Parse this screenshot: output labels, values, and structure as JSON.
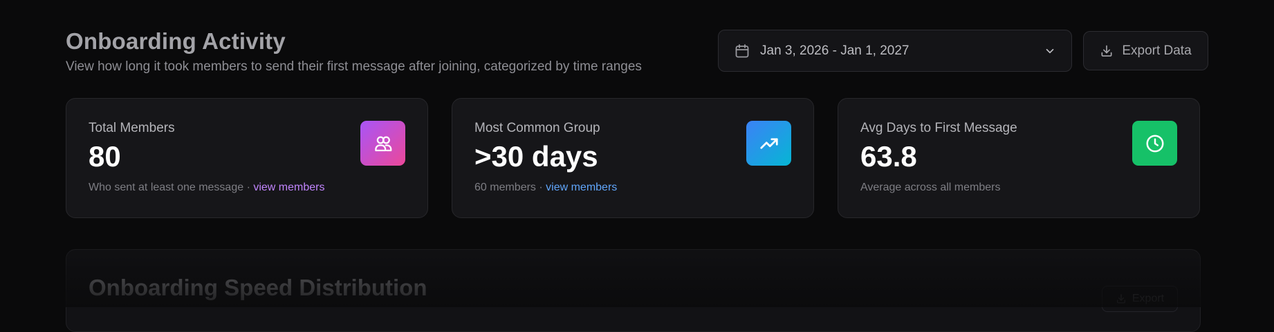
{
  "header": {
    "title": "Onboarding Activity",
    "subtitle": "View how long it took members to send their first message after joining, categorized by time ranges",
    "date_range": "Jan 3, 2026 - Jan 1, 2027",
    "export_label": "Export Data"
  },
  "cards": [
    {
      "label": "Total Members",
      "value": "80",
      "foot_text": "Who sent at least one message · ",
      "link": "view members",
      "icon": "users-icon",
      "color": "#c084fc"
    },
    {
      "label": "Most Common Group",
      "value": ">30 days",
      "foot_text": "60 members · ",
      "link": "view members",
      "icon": "trending-up-icon",
      "color": "#60a5fa"
    },
    {
      "label": "Avg Days to First Message",
      "value": "63.8",
      "foot_text": "Average across all members",
      "icon": "clock-icon",
      "color": "#16c168"
    }
  ],
  "section": {
    "title": "Onboarding Speed Distribution",
    "export_label": "Export"
  }
}
